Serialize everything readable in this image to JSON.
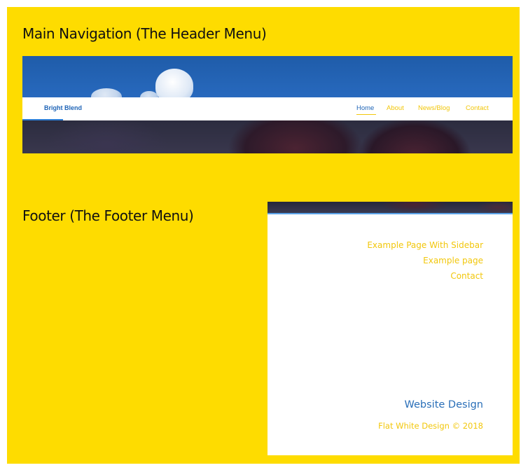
{
  "page": {
    "background_color": "#FEDC00"
  },
  "sections": {
    "header_heading": "Main Navigation (The Header Menu)",
    "footer_heading": "Footer (The Footer Menu)"
  },
  "header_preview": {
    "brand": "Bright Blend",
    "nav": [
      {
        "label": "Home",
        "active": true
      },
      {
        "label": "About",
        "active": false
      },
      {
        "label": "News/Blog",
        "active": false
      },
      {
        "label": "Contact",
        "active": false
      }
    ],
    "colors": {
      "brand": "#1E64B7",
      "link": "#F2C70C",
      "active_link": "#1E64B7"
    }
  },
  "footer_preview": {
    "links": [
      {
        "label": "Example Page With Sidebar"
      },
      {
        "label": "Example page"
      },
      {
        "label": "Contact"
      }
    ],
    "title": "Website Design",
    "copyright": "Flat White Design © 2018",
    "colors": {
      "link": "#F2C70C",
      "title": "#2A6FB8"
    }
  }
}
